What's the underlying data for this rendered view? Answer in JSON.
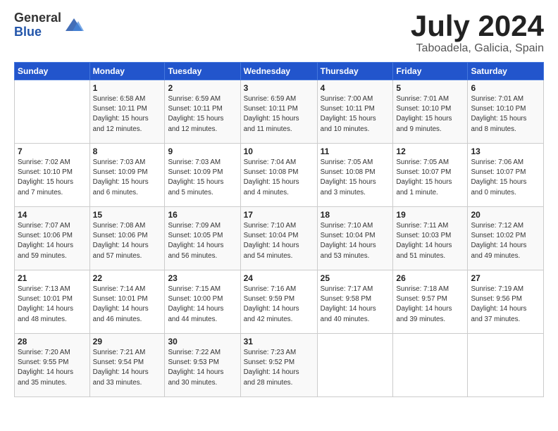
{
  "logo": {
    "general": "General",
    "blue": "Blue"
  },
  "title": "July 2024",
  "location": "Taboadela, Galicia, Spain",
  "weekdays": [
    "Sunday",
    "Monday",
    "Tuesday",
    "Wednesday",
    "Thursday",
    "Friday",
    "Saturday"
  ],
  "weeks": [
    [
      {
        "day": "",
        "info": ""
      },
      {
        "day": "1",
        "info": "Sunrise: 6:58 AM\nSunset: 10:11 PM\nDaylight: 15 hours\nand 12 minutes."
      },
      {
        "day": "2",
        "info": "Sunrise: 6:59 AM\nSunset: 10:11 PM\nDaylight: 15 hours\nand 12 minutes."
      },
      {
        "day": "3",
        "info": "Sunrise: 6:59 AM\nSunset: 10:11 PM\nDaylight: 15 hours\nand 11 minutes."
      },
      {
        "day": "4",
        "info": "Sunrise: 7:00 AM\nSunset: 10:11 PM\nDaylight: 15 hours\nand 10 minutes."
      },
      {
        "day": "5",
        "info": "Sunrise: 7:01 AM\nSunset: 10:10 PM\nDaylight: 15 hours\nand 9 minutes."
      },
      {
        "day": "6",
        "info": "Sunrise: 7:01 AM\nSunset: 10:10 PM\nDaylight: 15 hours\nand 8 minutes."
      }
    ],
    [
      {
        "day": "7",
        "info": "Sunrise: 7:02 AM\nSunset: 10:10 PM\nDaylight: 15 hours\nand 7 minutes."
      },
      {
        "day": "8",
        "info": "Sunrise: 7:03 AM\nSunset: 10:09 PM\nDaylight: 15 hours\nand 6 minutes."
      },
      {
        "day": "9",
        "info": "Sunrise: 7:03 AM\nSunset: 10:09 PM\nDaylight: 15 hours\nand 5 minutes."
      },
      {
        "day": "10",
        "info": "Sunrise: 7:04 AM\nSunset: 10:08 PM\nDaylight: 15 hours\nand 4 minutes."
      },
      {
        "day": "11",
        "info": "Sunrise: 7:05 AM\nSunset: 10:08 PM\nDaylight: 15 hours\nand 3 minutes."
      },
      {
        "day": "12",
        "info": "Sunrise: 7:05 AM\nSunset: 10:07 PM\nDaylight: 15 hours\nand 1 minute."
      },
      {
        "day": "13",
        "info": "Sunrise: 7:06 AM\nSunset: 10:07 PM\nDaylight: 15 hours\nand 0 minutes."
      }
    ],
    [
      {
        "day": "14",
        "info": "Sunrise: 7:07 AM\nSunset: 10:06 PM\nDaylight: 14 hours\nand 59 minutes."
      },
      {
        "day": "15",
        "info": "Sunrise: 7:08 AM\nSunset: 10:06 PM\nDaylight: 14 hours\nand 57 minutes."
      },
      {
        "day": "16",
        "info": "Sunrise: 7:09 AM\nSunset: 10:05 PM\nDaylight: 14 hours\nand 56 minutes."
      },
      {
        "day": "17",
        "info": "Sunrise: 7:10 AM\nSunset: 10:04 PM\nDaylight: 14 hours\nand 54 minutes."
      },
      {
        "day": "18",
        "info": "Sunrise: 7:10 AM\nSunset: 10:04 PM\nDaylight: 14 hours\nand 53 minutes."
      },
      {
        "day": "19",
        "info": "Sunrise: 7:11 AM\nSunset: 10:03 PM\nDaylight: 14 hours\nand 51 minutes."
      },
      {
        "day": "20",
        "info": "Sunrise: 7:12 AM\nSunset: 10:02 PM\nDaylight: 14 hours\nand 49 minutes."
      }
    ],
    [
      {
        "day": "21",
        "info": "Sunrise: 7:13 AM\nSunset: 10:01 PM\nDaylight: 14 hours\nand 48 minutes."
      },
      {
        "day": "22",
        "info": "Sunrise: 7:14 AM\nSunset: 10:01 PM\nDaylight: 14 hours\nand 46 minutes."
      },
      {
        "day": "23",
        "info": "Sunrise: 7:15 AM\nSunset: 10:00 PM\nDaylight: 14 hours\nand 44 minutes."
      },
      {
        "day": "24",
        "info": "Sunrise: 7:16 AM\nSunset: 9:59 PM\nDaylight: 14 hours\nand 42 minutes."
      },
      {
        "day": "25",
        "info": "Sunrise: 7:17 AM\nSunset: 9:58 PM\nDaylight: 14 hours\nand 40 minutes."
      },
      {
        "day": "26",
        "info": "Sunrise: 7:18 AM\nSunset: 9:57 PM\nDaylight: 14 hours\nand 39 minutes."
      },
      {
        "day": "27",
        "info": "Sunrise: 7:19 AM\nSunset: 9:56 PM\nDaylight: 14 hours\nand 37 minutes."
      }
    ],
    [
      {
        "day": "28",
        "info": "Sunrise: 7:20 AM\nSunset: 9:55 PM\nDaylight: 14 hours\nand 35 minutes."
      },
      {
        "day": "29",
        "info": "Sunrise: 7:21 AM\nSunset: 9:54 PM\nDaylight: 14 hours\nand 33 minutes."
      },
      {
        "day": "30",
        "info": "Sunrise: 7:22 AM\nSunset: 9:53 PM\nDaylight: 14 hours\nand 30 minutes."
      },
      {
        "day": "31",
        "info": "Sunrise: 7:23 AM\nSunset: 9:52 PM\nDaylight: 14 hours\nand 28 minutes."
      },
      {
        "day": "",
        "info": ""
      },
      {
        "day": "",
        "info": ""
      },
      {
        "day": "",
        "info": ""
      }
    ]
  ]
}
